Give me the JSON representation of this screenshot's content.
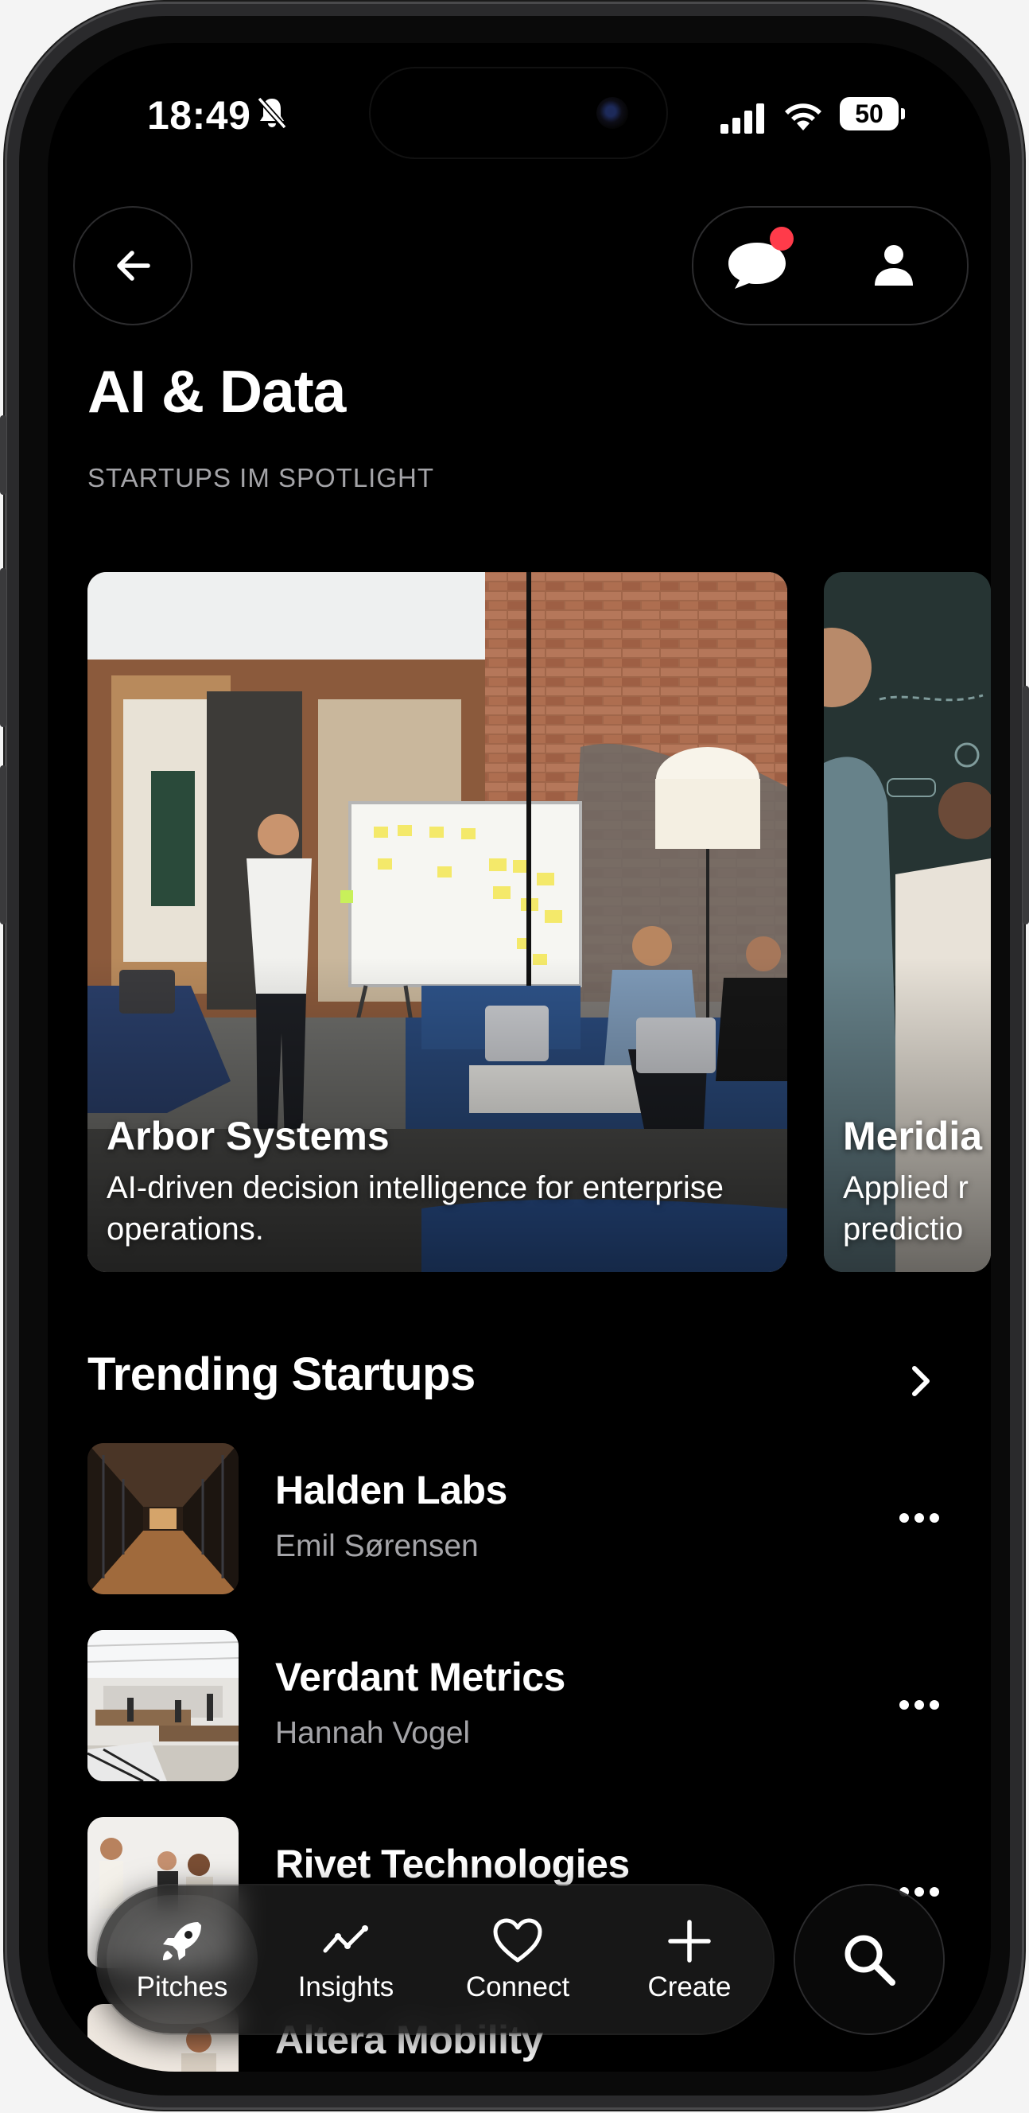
{
  "status_bar": {
    "time": "18:49",
    "battery": "50"
  },
  "header": {
    "title": "AI & Data",
    "kicker": "STARTUPS IM SPOTLIGHT"
  },
  "spotlight": [
    {
      "name": "Arbor Systems",
      "description": "AI-driven decision intelligence for enterprise operations."
    },
    {
      "name": "Meridia",
      "description": "Applied r\npredictio"
    }
  ],
  "trending": {
    "title": "Trending Startups",
    "items": [
      {
        "name": "Halden Labs",
        "founder": "Emil Sørensen"
      },
      {
        "name": "Verdant Metrics",
        "founder": "Hannah Vogel"
      },
      {
        "name": "Rivet Technologies",
        "founder": ""
      },
      {
        "name": "Altera Mobility",
        "founder": ""
      }
    ]
  },
  "tabbar": {
    "tabs": [
      {
        "label": "Pitches",
        "icon": "rocket-icon",
        "active": true
      },
      {
        "label": "Insights",
        "icon": "trend-line-icon",
        "active": false
      },
      {
        "label": "Connect",
        "icon": "heart-icon",
        "active": false
      },
      {
        "label": "Create",
        "icon": "plus-icon",
        "active": false
      }
    ],
    "search_icon": "search-icon"
  },
  "colors": {
    "background": "#000000",
    "notification_dot": "#ff3b4a",
    "secondary_text": "#a4a4a8"
  }
}
